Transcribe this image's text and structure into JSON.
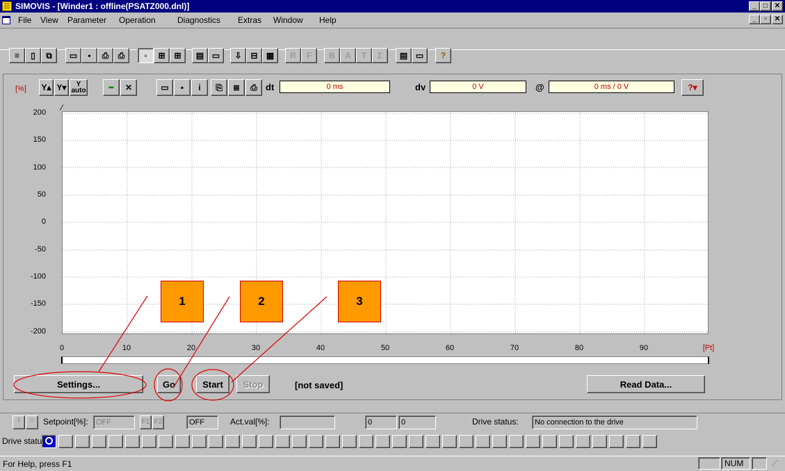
{
  "window": {
    "title": "SIMOVIS - [Winder1 : offline(PSATZ000.dnl)]"
  },
  "menu": [
    "File",
    "View",
    "Parameter",
    "Operation",
    "Diagnostics",
    "Extras",
    "Window",
    "Help"
  ],
  "scope": {
    "unit_label": "[%]",
    "auto_label": "auto",
    "dt_label": "dt",
    "dt_value": "0 ms",
    "dv_label": "dv",
    "dv_value": "0 V",
    "at_label": "@",
    "at_value": "0 ms / 0 V",
    "help_label": "?"
  },
  "plot": {
    "y_ticks": [
      "200",
      "150",
      "100",
      "50",
      "0",
      "-50",
      "-100",
      "-150",
      "-200"
    ],
    "x_ticks": [
      "0",
      "10",
      "20",
      "30",
      "40",
      "50",
      "60",
      "70",
      "80",
      "90"
    ],
    "x_unit": "[Pt]"
  },
  "buttons": {
    "settings": "Settings...",
    "go": "Go",
    "start": "Start",
    "stop": "Stop",
    "status": "[not saved]",
    "read_data": "Read Data..."
  },
  "callouts": [
    "1",
    "2",
    "3"
  ],
  "status": {
    "setpoint_label": "Setpoint[%]:",
    "setpoint_value": "OFF",
    "f1": "F1",
    "f2": "F2",
    "off_value": "OFF",
    "actval_label": "Act.val[%]:",
    "val1": "0",
    "val2": "0",
    "drive_status_label": "Drive status:",
    "drive_status_value": "No connection to the drive",
    "drive_status_row_label": "Drive status:",
    "help_text": "For Help, press F1",
    "num": "NUM"
  },
  "colors": {
    "title_bg": "#000080",
    "callout": "#ff9900",
    "annotation": "#e00000",
    "field_bg": "#ffffe1"
  }
}
